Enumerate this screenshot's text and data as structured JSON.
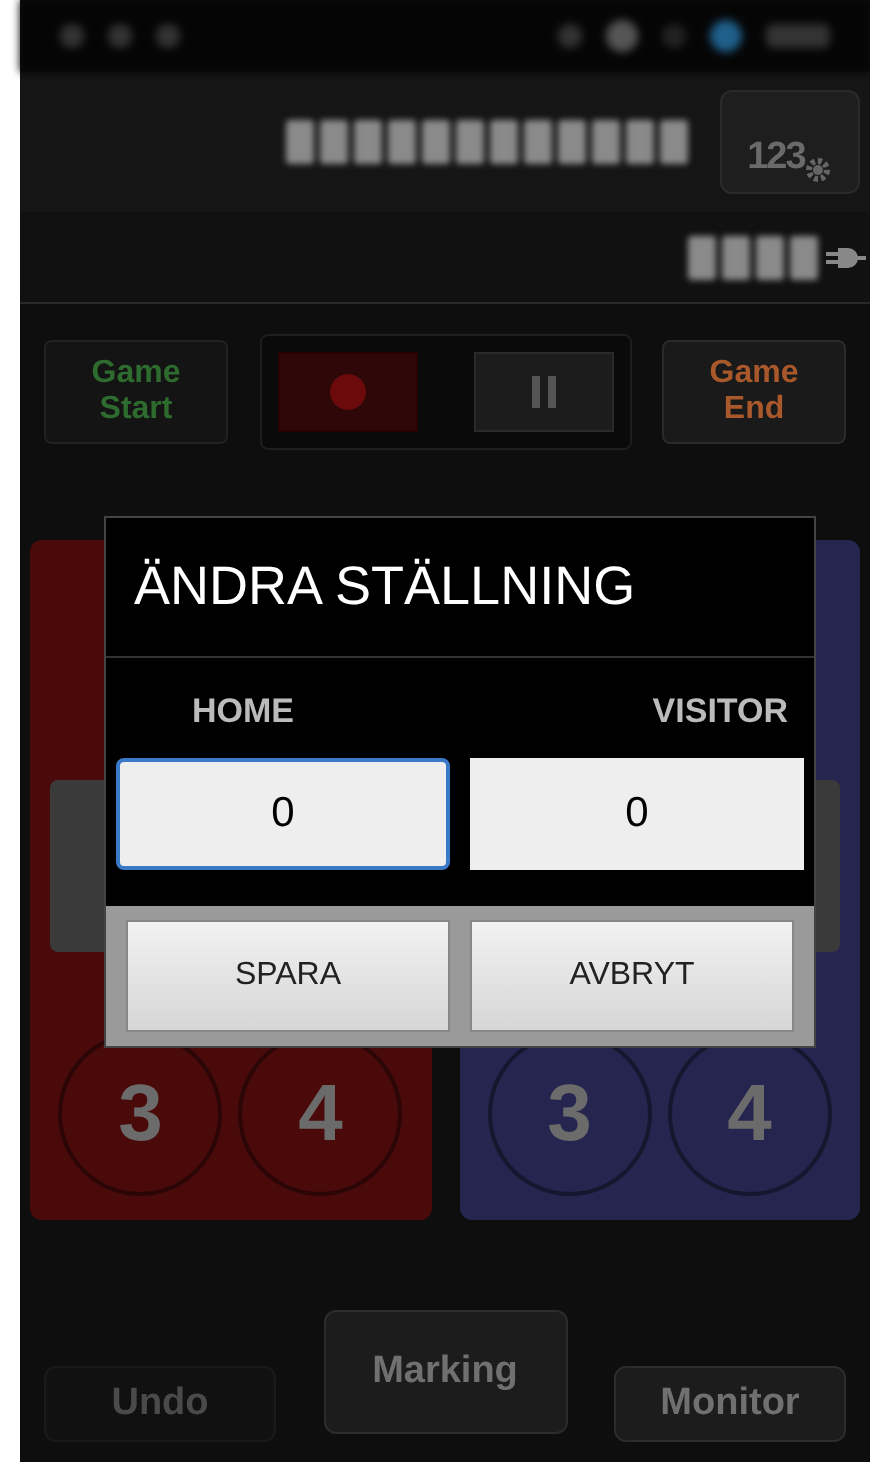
{
  "clock_button": {
    "label": "123"
  },
  "controls": {
    "game_start": {
      "label": "Game Start",
      "disabled": true
    },
    "record": {
      "selected": true
    },
    "game_end": {
      "label": "Game End",
      "disabled": false
    }
  },
  "teams": [
    {
      "color": "#4a0a0a",
      "buttons": [
        "3",
        "4"
      ]
    },
    {
      "color": "#25254f",
      "buttons": [
        "3",
        "4"
      ]
    }
  ],
  "dialog": {
    "title": "ÄNDRA STÄLLNING",
    "fields": [
      {
        "label": "HOME",
        "value": "0",
        "focused": true
      },
      {
        "label": "VISITOR",
        "value": "0",
        "focused": false
      }
    ],
    "buttons": [
      "SPARA",
      "AVBRYT"
    ]
  },
  "bottom_bar": [
    {
      "label": "Undo",
      "disabled": true
    },
    {
      "label": "Marking",
      "disabled": false
    },
    {
      "label": "Monitor",
      "disabled": false
    }
  ]
}
